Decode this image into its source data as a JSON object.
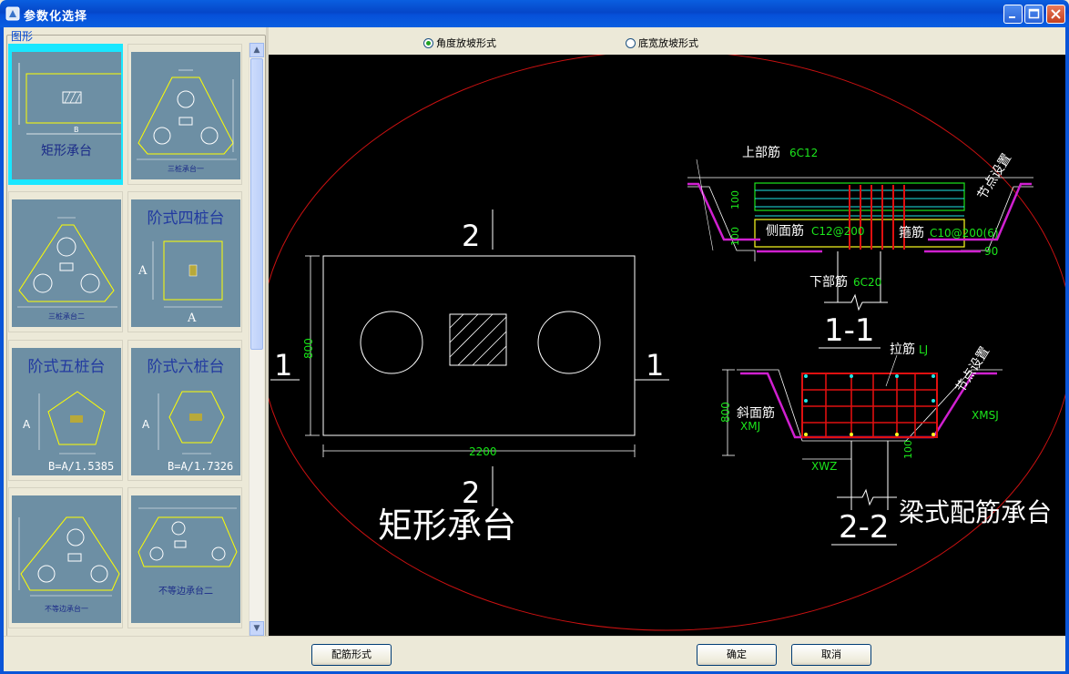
{
  "window": {
    "title": "参数化选择"
  },
  "left_panel": {
    "group_label": "图形",
    "thumbnails": [
      {
        "caption": "矩形承台",
        "dim": "B"
      },
      {
        "caption": "三桩承台一"
      },
      {
        "caption": "三桩承台二"
      },
      {
        "caption": "阶式四桩台",
        "dim": "A"
      },
      {
        "caption": "阶式五桩台",
        "formula": "B=A/1.5385",
        "dim": "A"
      },
      {
        "caption": "阶式六桩台",
        "formula": "B=A/1.7326",
        "dim": "A"
      },
      {
        "caption": "不等边承台一"
      },
      {
        "caption": "不等边承台二"
      }
    ]
  },
  "radio": {
    "options": [
      {
        "label": "角度放坡形式",
        "selected": true
      },
      {
        "label": "底宽放坡形式",
        "selected": false
      }
    ]
  },
  "drawing": {
    "plan_title": "矩形承台",
    "plan_section_marks": {
      "top": "2",
      "bottom": "2",
      "left": "1",
      "right": "1"
    },
    "plan_dims": {
      "width": "2200",
      "height": "800"
    },
    "section11": {
      "title": "1-1",
      "top_bar_label": "上部筋",
      "top_bar_value": "6C12",
      "side_bar_label": "侧面筋",
      "side_bar_value": "C12@200",
      "stirrup_label": "箍筋",
      "stirrup_value": "C10@200(6)",
      "bottom_bar_label": "下部筋",
      "bottom_bar_value": "6C20",
      "node_label": "节点设置",
      "dim_top": "100",
      "dim_bottom": "100",
      "angle": "90"
    },
    "section22": {
      "title": "2-2",
      "tie_label": "拉筋",
      "tie_value": "LJ",
      "slope_label": "斜面筋",
      "slope_value": "XMJ",
      "xmsj": "XMSJ",
      "xwz": "XWZ",
      "node_label": "节点设置",
      "dim_height": "800",
      "dim_small": "100"
    },
    "beam_title": "梁式配筋承台"
  },
  "buttons": {
    "rebar_form": "配筋形式",
    "ok": "确定",
    "cancel": "取消"
  },
  "colors": {
    "title_bar": "#0a5fe0",
    "canvas": "#000000",
    "selected_thumb": "#19e7ff",
    "ellipse": "#cc1111"
  }
}
